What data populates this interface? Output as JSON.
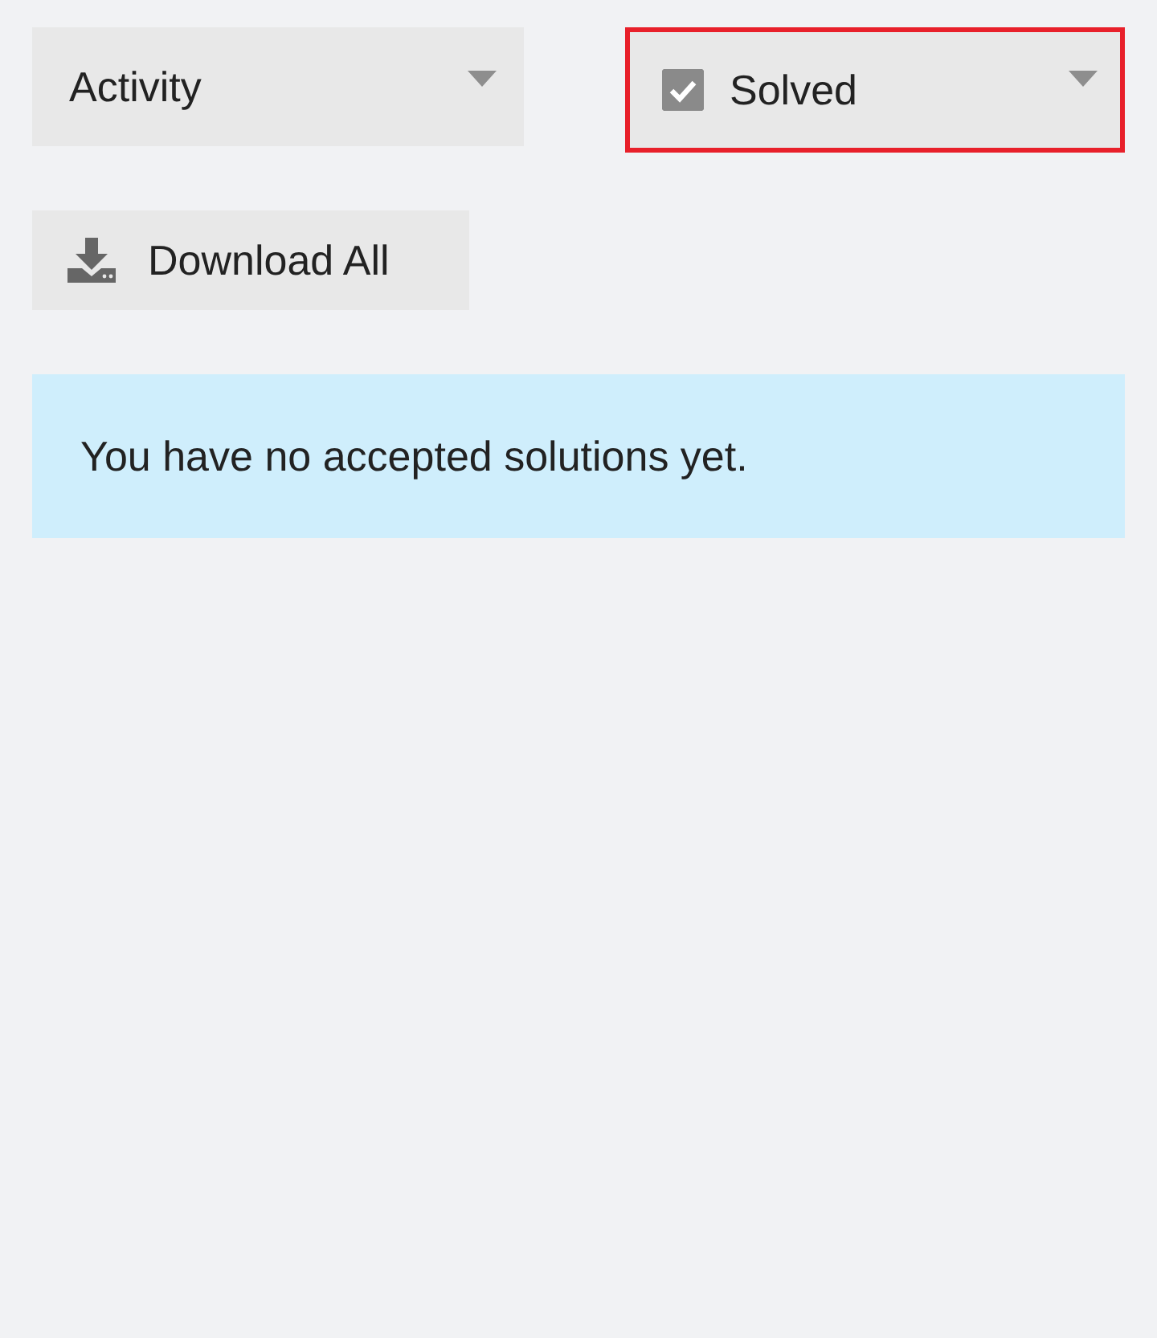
{
  "filters": [
    {
      "label": "Activity",
      "kind": "select",
      "highlighted": false
    },
    {
      "label": "Solved",
      "kind": "checkbox-select",
      "checked": true,
      "highlighted": true
    }
  ],
  "download_button": {
    "label": "Download All"
  },
  "notice": {
    "text": "You have no accepted solutions yet."
  }
}
